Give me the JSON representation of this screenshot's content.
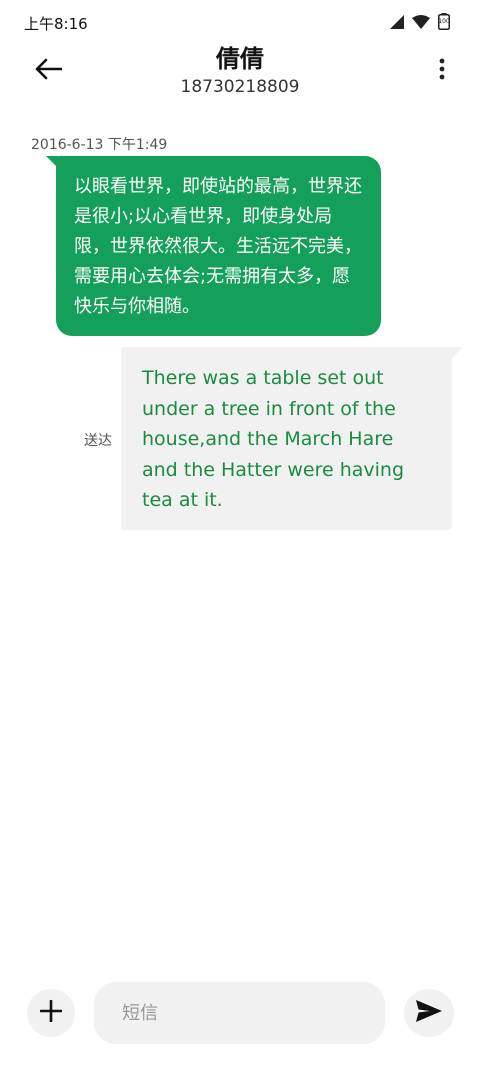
{
  "status_bar": {
    "time": "上午8:16",
    "battery": "100"
  },
  "header": {
    "contact_name": "倩倩",
    "contact_number": "18730218809"
  },
  "conversation": {
    "timestamp": "2016-6-13 下午1:49",
    "messages": [
      {
        "direction": "incoming",
        "text": "以眼看世界，即使站的最高，世界还是很小;以心看世界，即使身处局限，世界依然很大。生活远不完美，需要用心去体会;无需拥有太多，愿快乐与你相随。"
      },
      {
        "direction": "outgoing",
        "text": "There was a table set out under a tree in front of the house,and the March Hare and the Hatter were having tea at it.",
        "status": "送达"
      }
    ]
  },
  "composer": {
    "placeholder": "短信",
    "value": ""
  },
  "colors": {
    "incoming_bubble": "#14a05a",
    "outgoing_bubble": "#f1f1f1",
    "outgoing_text": "#1a8c3e"
  },
  "icons": {
    "back": "arrow-left-icon",
    "more": "more-vertical-icon",
    "add": "plus-icon",
    "send": "send-icon",
    "signal": "signal-icon",
    "wifi": "wifi-icon",
    "battery": "battery-icon"
  }
}
